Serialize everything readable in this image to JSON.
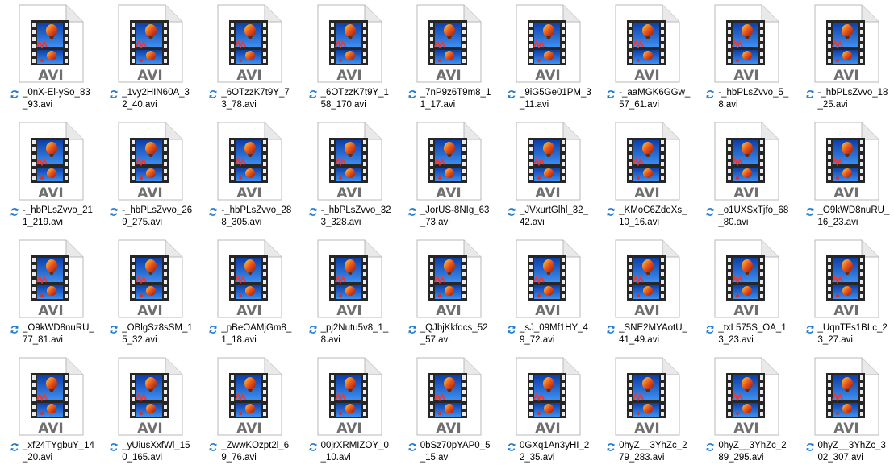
{
  "view": {
    "icon_type_label": "AVI",
    "file_icon": "avi-video-file-icon",
    "sync_icon": "sync-pending-icon",
    "accent_blue": "#1a78d0"
  },
  "files": [
    "_0nX-El-ySo_83_93.avi",
    "_1vy2HIN60A_32_40.avi",
    "_6OTzzK7t9Y_73_78.avi",
    "_6OTzzK7t9Y_158_170.avi",
    "_7nP9z6T9m8_11_17.avi",
    "_9iG5Ge01PM_3_11.avi",
    "-_aaMGK6GGw_57_61.avi",
    "-_hbPLsZvvo_5_8.avi",
    "-_hbPLsZvvo_18_25.avi",
    "-_hbPLsZvvo_211_219.avi",
    "-_hbPLsZvvo_269_275.avi",
    "-_hbPLsZvvo_288_305.avi",
    "-_hbPLsZvvo_323_328.avi",
    "_JorUS-8NIg_63_73.avi",
    "_JVxurtGlhl_32_42.avi",
    "_KMoC6ZdeXs_10_16.avi",
    "_o1UXSxTjfo_68_80.avi",
    "_O9kWD8nuRU_16_23.avi",
    "_O9kWD8nuRU_77_81.avi",
    "_OBlgSz8sSM_15_32.avi",
    "_pBeOAMjGm8_1_18.avi",
    "_pj2Nutu5v8_1_8.avi",
    "_QJbjKkfdcs_52_57.avi",
    "_sJ_09Mf1HY_49_72.avi",
    "_SNE2MYAotU_41_49.avi",
    "_txL575S_OA_13_23.avi",
    "_UqnTFs1BLc_23_27.avi",
    "_xf24TYgbuY_14_20.avi",
    "_yUiusXxfWl_150_165.avi",
    "_ZwwKOzpt2l_69_76.avi",
    "00jrXRMIZOY_0_10.avi",
    "0bSz70pYAP0_5_15.avi",
    "0GXq1An3yHI_22_35.avi",
    "0hyZ__3YhZc_279_283.avi",
    "0hyZ__3YhZc_289_295.avi",
    "0hyZ__3YhZc_302_307.avi"
  ]
}
